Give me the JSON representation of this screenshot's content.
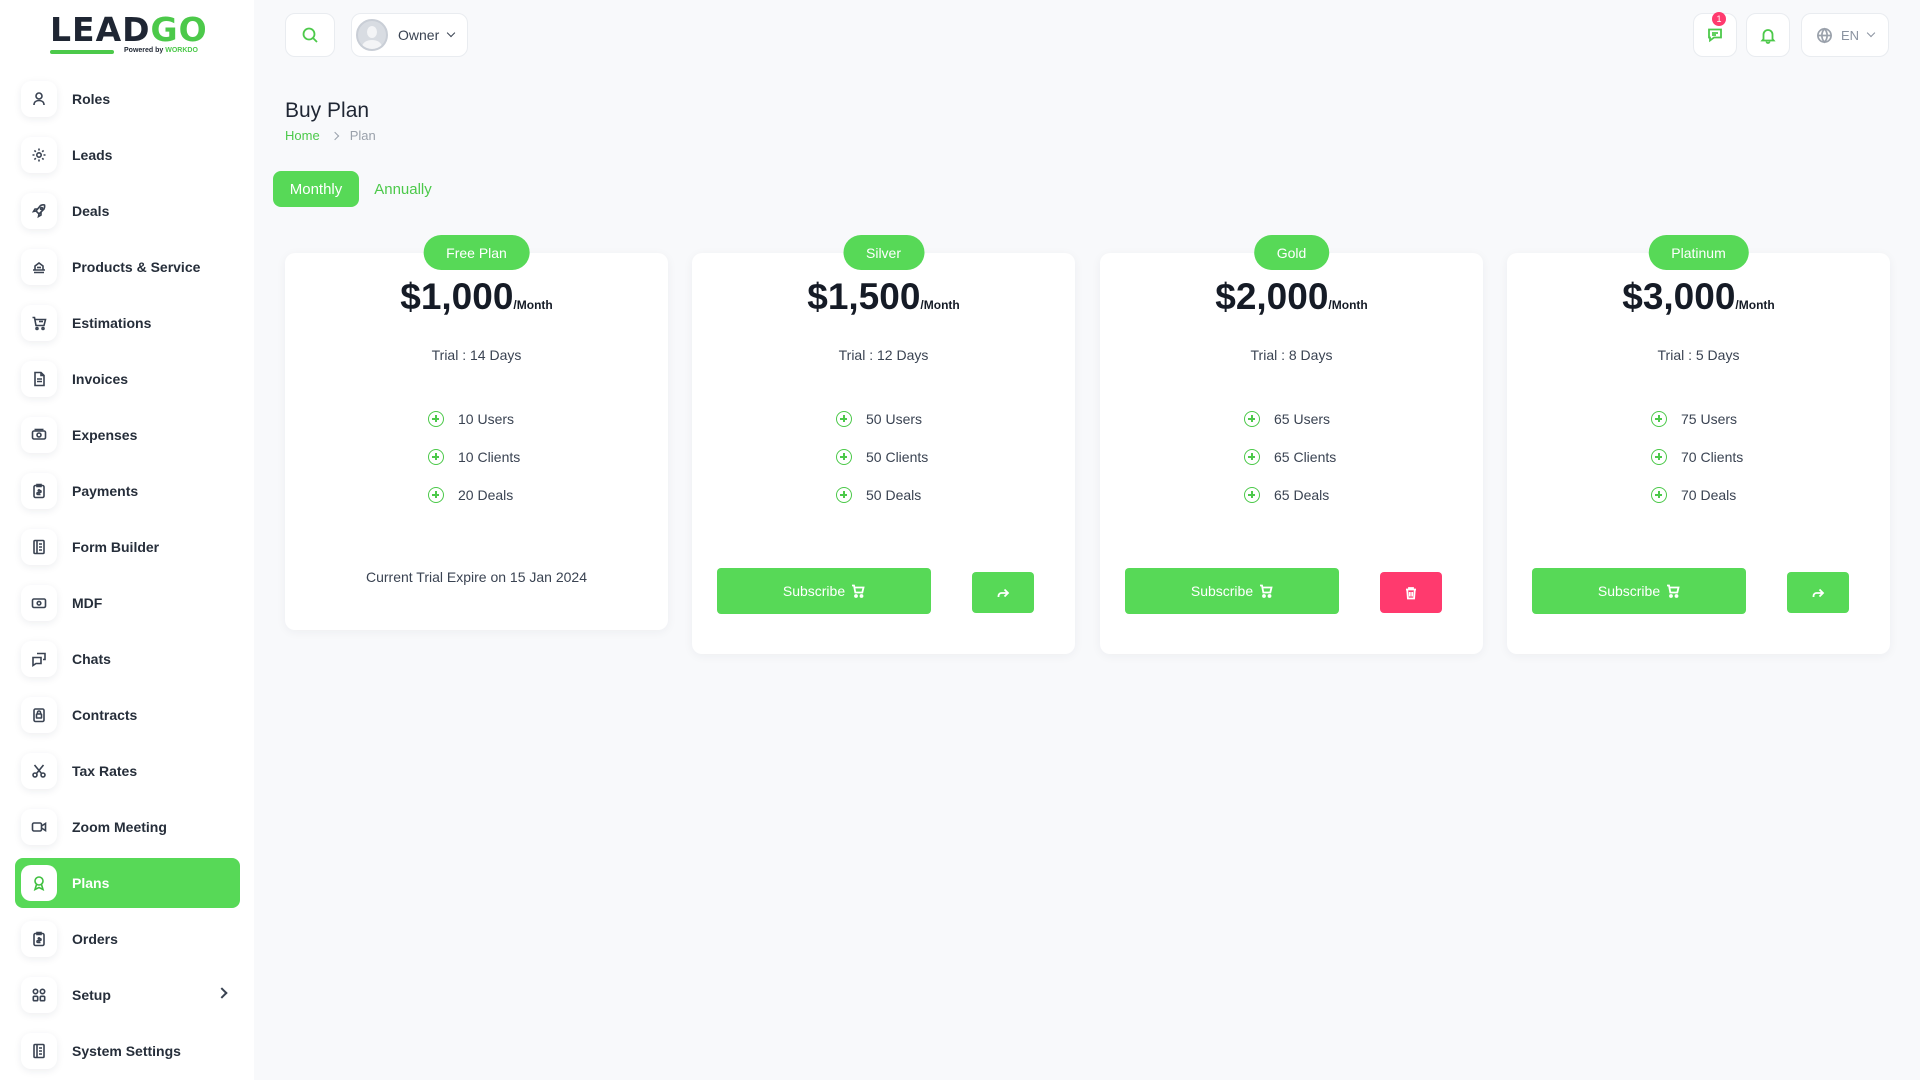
{
  "brand": {
    "logo_main": "LEAD",
    "logo_accent": "GO",
    "logo_powered": "Powered by",
    "logo_powered_brand": "WORKDO"
  },
  "sidebar": {
    "items": [
      {
        "label": "Roles",
        "icon": "user-icon"
      },
      {
        "label": "Leads",
        "icon": "lead-icon"
      },
      {
        "label": "Deals",
        "icon": "rocket-icon"
      },
      {
        "label": "Products & Service",
        "icon": "box-icon"
      },
      {
        "label": "Estimations",
        "icon": "cart-icon"
      },
      {
        "label": "Invoices",
        "icon": "file-icon"
      },
      {
        "label": "Expenses",
        "icon": "money-icon"
      },
      {
        "label": "Payments",
        "icon": "clipboard-icon"
      },
      {
        "label": "Form Builder",
        "icon": "form-icon"
      },
      {
        "label": "MDF",
        "icon": "cash-icon"
      },
      {
        "label": "Chats",
        "icon": "chat-icon"
      },
      {
        "label": "Contracts",
        "icon": "contract-icon"
      },
      {
        "label": "Tax Rates",
        "icon": "scissors-icon"
      },
      {
        "label": "Zoom Meeting",
        "icon": "video-icon"
      },
      {
        "label": "Plans",
        "icon": "award-icon",
        "active": true
      },
      {
        "label": "Orders",
        "icon": "clipboard-icon"
      },
      {
        "label": "Setup",
        "icon": "grid-icon",
        "has_submenu": true
      },
      {
        "label": "System Settings",
        "icon": "settings-icon"
      }
    ]
  },
  "header": {
    "user_label": "Owner",
    "messages_badge": "1",
    "language": "EN"
  },
  "page": {
    "title": "Buy Plan",
    "breadcrumb_home": "Home",
    "breadcrumb_current": "Plan"
  },
  "tabs": {
    "monthly": "Monthly",
    "annually": "Annually",
    "active": "monthly"
  },
  "plans": [
    {
      "name": "Free Plan",
      "price": "$1,000",
      "period": "/Month",
      "trial": "Trial : 14 Days",
      "features": [
        "10 Users",
        "10 Clients",
        "20 Deals"
      ],
      "footer_text": "Current Trial Expire on 15 Jan 2024"
    },
    {
      "name": "Silver",
      "price": "$1,500",
      "period": "/Month",
      "trial": "Trial : 12 Days",
      "features": [
        "50 Users",
        "50 Clients",
        "50 Deals"
      ],
      "subscribe_label": "Subscribe",
      "side_action": "refer-icon"
    },
    {
      "name": "Gold",
      "price": "$2,000",
      "period": "/Month",
      "trial": "Trial : 8 Days",
      "features": [
        "65 Users",
        "65 Clients",
        "65 Deals"
      ],
      "subscribe_label": "Subscribe",
      "side_action": "trash-icon"
    },
    {
      "name": "Platinum",
      "price": "$3,000",
      "period": "/Month",
      "trial": "Trial : 5 Days",
      "features": [
        "75 Users",
        "70 Clients",
        "70 Deals"
      ],
      "subscribe_label": "Subscribe",
      "side_action": "refer-icon"
    }
  ],
  "colors": {
    "accent": "#57d957",
    "danger": "#ff3a6e"
  }
}
